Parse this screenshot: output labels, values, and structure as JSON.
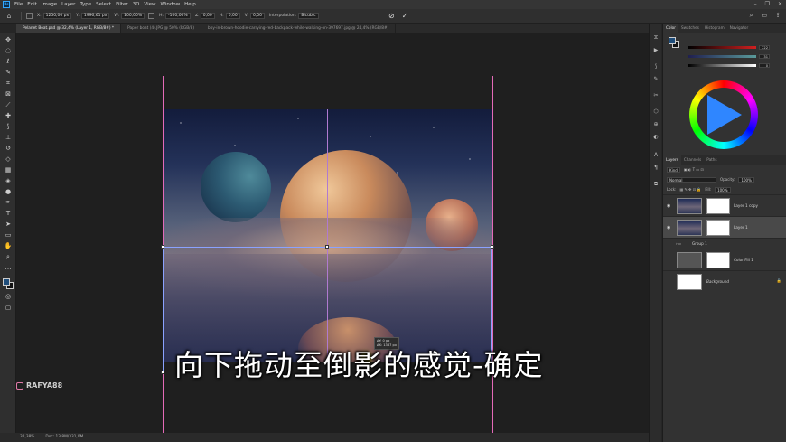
{
  "menubar": {
    "logo": "Ps",
    "items": [
      "File",
      "Edit",
      "Image",
      "Layer",
      "Type",
      "Select",
      "Filter",
      "3D",
      "View",
      "Window",
      "Help"
    ]
  },
  "optionsbar": {
    "x_label": "X:",
    "x_value": "1250,00 px",
    "y_label": "Y:",
    "y_value": "1996,61 px",
    "w_label": "W:",
    "w_value": "100,00%",
    "h_label": "H:",
    "h_value": "-100,00%",
    "angle_value": "0,00",
    "h_skew_label": "H:",
    "h_skew_value": "0,00",
    "v_skew_label": "V:",
    "v_skew_value": "0,00",
    "interp_label": "Interpolation:",
    "interp_value": "Bicubic"
  },
  "tabs": [
    "Pelanet Boat.psd @ 32,4% (Layer 1, RGB/8#) *",
    "Paper boat (4).JPG @ 50% (RGB/8)",
    "boy-in-brown-hoodie-carrying-red-backpack-while-walking-on-397697.jpg @ 24,4% (RGB/8#)"
  ],
  "canvas": {
    "tooltip_line1": "ΔY: 0 px",
    "tooltip_line2": "ΔX: 1387 px"
  },
  "subtitle": "向下拖动至倒影的感觉-确定",
  "watermark": "RAFYA88",
  "statusbar": {
    "zoom": "32,38%",
    "doc": "Doc: 13,8M/331,0M"
  },
  "color_panel": {
    "tabs": [
      "Color",
      "Swatches",
      "Histogram",
      "Navigator"
    ],
    "slider_values": [
      "222",
      "31",
      "0"
    ]
  },
  "layers_panel": {
    "tabs": [
      "Layers",
      "Channels",
      "Paths"
    ],
    "kind_label": "Kind",
    "blend_mode": "Normal",
    "opacity_label": "Opacity:",
    "opacity_value": "100%",
    "lock_label": "Lock:",
    "fill_label": "Fill:",
    "fill_value": "100%",
    "layers": [
      {
        "name": "Layer 1 copy"
      },
      {
        "name": "Layer 1"
      },
      {
        "name": "Group 1"
      },
      {
        "name": "Color Fill 1"
      },
      {
        "name": "Background"
      }
    ]
  },
  "colors": {
    "foreground": "#1f4d7a",
    "guide": "#e36ab8",
    "transform": "#8aa2ff"
  }
}
